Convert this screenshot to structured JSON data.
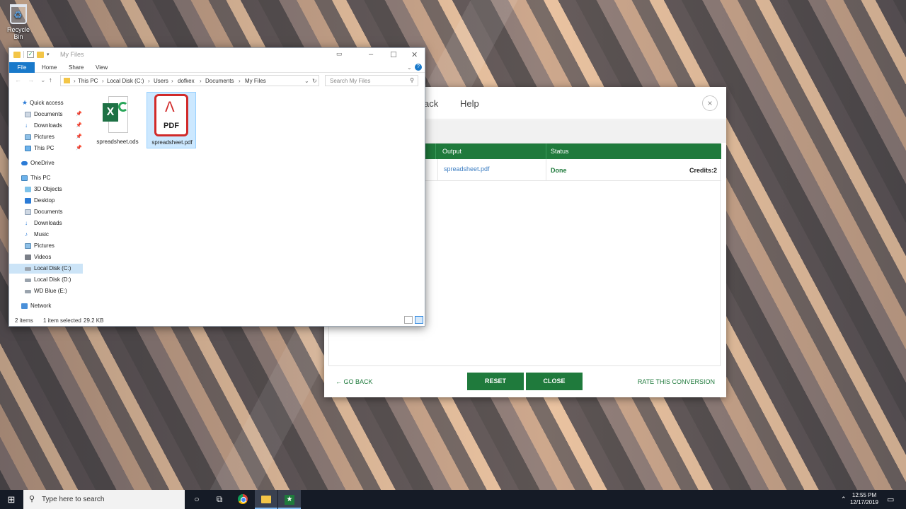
{
  "desktop": {
    "recycle_bin_label": "Recycle Bin"
  },
  "converter": {
    "nav_back_partial": "ack",
    "nav_help": "Help",
    "close_x": "×",
    "table": {
      "headers": [
        "Output",
        "Status"
      ],
      "rows": [
        {
          "output": "spreadsheet.pdf",
          "status": "Done",
          "credits": "Credits:2"
        }
      ]
    },
    "footer": {
      "go_back": "GO BACK",
      "reset": "RESET",
      "close": "CLOSE",
      "rate": "RATE THIS CONVERSION"
    }
  },
  "explorer": {
    "title": "My Files",
    "ribbon_tabs": {
      "file": "File",
      "home": "Home",
      "share": "Share",
      "view": "View"
    },
    "breadcrumb": [
      "This PC",
      "Local Disk (C:)",
      "Users",
      "dofkex",
      "Documents",
      "My Files"
    ],
    "search_placeholder": "Search My Files",
    "nav": {
      "quick_access": "Quick access",
      "qa_items": [
        "Documents",
        "Downloads",
        "Pictures",
        "This PC"
      ],
      "onedrive": "OneDrive",
      "this_pc": "This PC",
      "pc_items": [
        "3D Objects",
        "Desktop",
        "Documents",
        "Downloads",
        "Music",
        "Pictures",
        "Videos",
        "Local Disk (C:)",
        "Local Disk (D:)",
        "WD Blue (E:)"
      ],
      "network": "Network"
    },
    "files": [
      {
        "name": "spreadsheet.ods",
        "type": "ods"
      },
      {
        "name": "spreadsheet.pdf",
        "type": "pdf",
        "pdf_label": "PDF"
      }
    ],
    "status": {
      "count": "2 items",
      "selected": "1 item selected",
      "size": "29.2 KB"
    }
  },
  "taskbar": {
    "search_placeholder": "Type here to search",
    "time": "12:55 PM",
    "date": "12/17/2019"
  },
  "colors": {
    "accent_green": "#1f7a3c",
    "link_blue": "#3b7dc2",
    "ribbon_blue": "#1979ca"
  }
}
